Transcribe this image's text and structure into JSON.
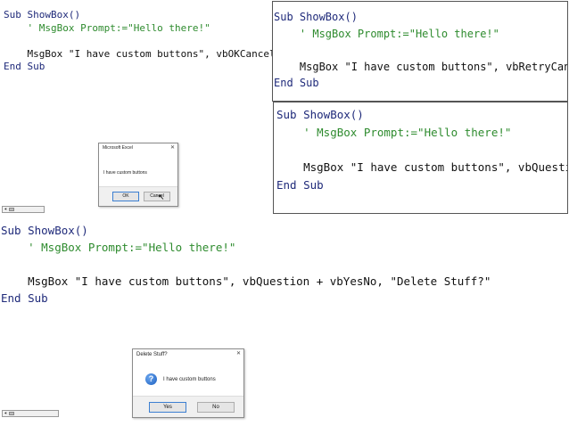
{
  "panel1": {
    "code_lines": [
      [
        {
          "t": "Sub ShowBox()",
          "c": "kw"
        }
      ],
      [
        {
          "t": "    ' MsgBox Prompt:=\"Hello there!\"",
          "c": "cm"
        }
      ],
      [
        {
          "t": "",
          "c": "tx"
        }
      ],
      [
        {
          "t": "    MsgBox \"I have custom buttons\", vbOKCancel",
          "c": "tx"
        }
      ],
      [
        {
          "t": "End Sub",
          "c": "kw"
        }
      ]
    ],
    "dialog": {
      "title": "Microsoft Excel",
      "close": "✕",
      "message": "I have custom buttons",
      "ok_label": "OK",
      "cancel_label": "Cancel"
    }
  },
  "panel2": {
    "code_lines": [
      [
        {
          "t": "Sub ShowBox()",
          "c": "kw"
        }
      ],
      [
        {
          "t": "    ' MsgBox Prompt:=\"Hello there!\"",
          "c": "cm"
        }
      ],
      [
        {
          "t": "",
          "c": "tx"
        }
      ],
      [
        {
          "t": "    MsgBox \"I have custom buttons\", vbRetryCancel",
          "c": "tx"
        }
      ],
      [
        {
          "t": "End Sub",
          "c": "kw"
        }
      ]
    ]
  },
  "panel3": {
    "code_lines": [
      [
        {
          "t": "Sub ShowBox()",
          "c": "kw"
        }
      ],
      [
        {
          "t": "    ' MsgBox Prompt:=\"Hello there!\"",
          "c": "cm"
        }
      ],
      [
        {
          "t": "",
          "c": "tx"
        }
      ],
      [
        {
          "t": "    MsgBox \"I have custom buttons\", vbQuestion",
          "c": "tx"
        }
      ],
      [
        {
          "t": "End Sub",
          "c": "kw"
        }
      ]
    ]
  },
  "panel4": {
    "code_lines": [
      [
        {
          "t": "Sub ShowBox()",
          "c": "kw"
        }
      ],
      [
        {
          "t": "    ' MsgBox Prompt:=\"Hello there!\"",
          "c": "cm"
        }
      ],
      [
        {
          "t": "",
          "c": "tx"
        }
      ],
      [
        {
          "t": "    MsgBox \"I have custom buttons\", vbQuestion + vbYesNo, \"Delete Stuff?\"",
          "c": "tx"
        }
      ],
      [
        {
          "t": "End Sub",
          "c": "kw"
        }
      ]
    ],
    "dialog": {
      "title": "Delete Stuff?",
      "close": "✕",
      "icon_glyph": "?",
      "message": "I have custom buttons",
      "yes_label": "Yes",
      "no_label": "No"
    }
  },
  "scrollbar": {
    "arrow": "◂"
  },
  "colors": {
    "keyword": "#1f2a7a",
    "comment": "#2e8b2e",
    "text": "#111111",
    "focus": "#3c7fd1"
  }
}
